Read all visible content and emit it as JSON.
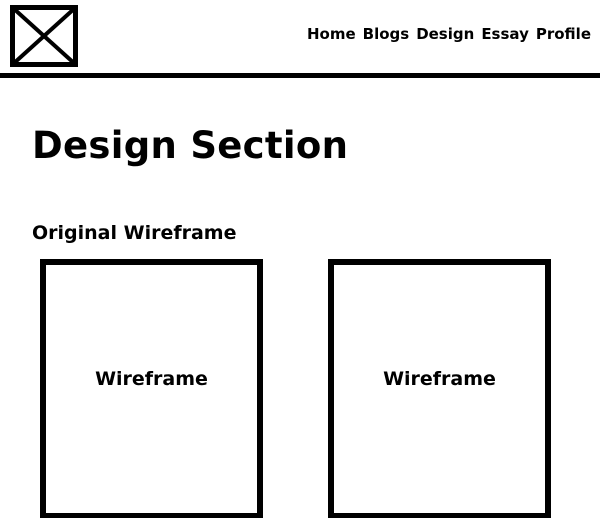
{
  "header": {
    "logo_icon": "image-placeholder-icon",
    "nav": [
      {
        "label": "Home"
      },
      {
        "label": "Blogs"
      },
      {
        "label": "Design"
      },
      {
        "label": "Essay"
      },
      {
        "label": "Profile"
      }
    ]
  },
  "main": {
    "title": "Design Section",
    "section_title": "Original Wireframe",
    "wireframes": [
      {
        "label": "Wireframe"
      },
      {
        "label": "Wireframe"
      }
    ]
  }
}
